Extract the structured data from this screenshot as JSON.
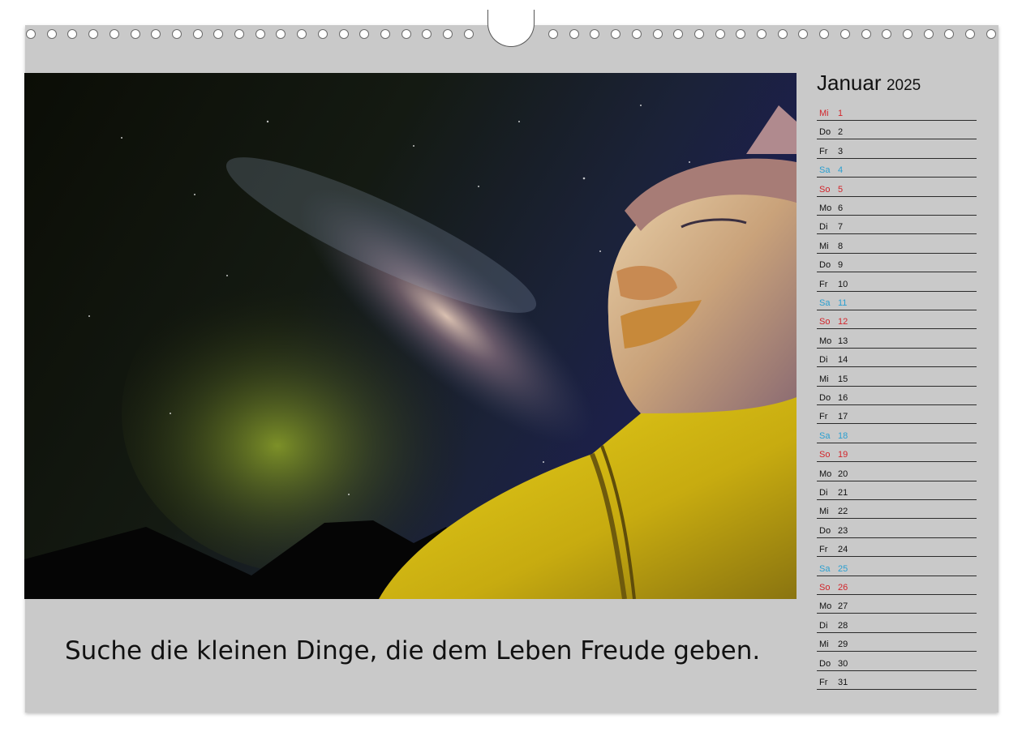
{
  "quote": "Suche die kleinen Dinge, die dem Leben Freude geben.",
  "calendar": {
    "month": "Januar",
    "year": "2025",
    "colors": {
      "weekday": "#111111",
      "saturday": "#2a9fd0",
      "sunday": "#d2252b"
    },
    "days": [
      {
        "wd": "Mi",
        "d": "1",
        "type": "holiday"
      },
      {
        "wd": "Do",
        "d": "2",
        "type": "weekday"
      },
      {
        "wd": "Fr",
        "d": "3",
        "type": "weekday"
      },
      {
        "wd": "Sa",
        "d": "4",
        "type": "saturday"
      },
      {
        "wd": "So",
        "d": "5",
        "type": "sunday"
      },
      {
        "wd": "Mo",
        "d": "6",
        "type": "weekday"
      },
      {
        "wd": "Di",
        "d": "7",
        "type": "weekday"
      },
      {
        "wd": "Mi",
        "d": "8",
        "type": "weekday"
      },
      {
        "wd": "Do",
        "d": "9",
        "type": "weekday"
      },
      {
        "wd": "Fr",
        "d": "10",
        "type": "weekday"
      },
      {
        "wd": "Sa",
        "d": "11",
        "type": "saturday"
      },
      {
        "wd": "So",
        "d": "12",
        "type": "sunday"
      },
      {
        "wd": "Mo",
        "d": "13",
        "type": "weekday"
      },
      {
        "wd": "Di",
        "d": "14",
        "type": "weekday"
      },
      {
        "wd": "Mi",
        "d": "15",
        "type": "weekday"
      },
      {
        "wd": "Do",
        "d": "16",
        "type": "weekday"
      },
      {
        "wd": "Fr",
        "d": "17",
        "type": "weekday"
      },
      {
        "wd": "Sa",
        "d": "18",
        "type": "saturday"
      },
      {
        "wd": "So",
        "d": "19",
        "type": "sunday"
      },
      {
        "wd": "Mo",
        "d": "20",
        "type": "weekday"
      },
      {
        "wd": "Di",
        "d": "21",
        "type": "weekday"
      },
      {
        "wd": "Mi",
        "d": "22",
        "type": "weekday"
      },
      {
        "wd": "Do",
        "d": "23",
        "type": "weekday"
      },
      {
        "wd": "Fr",
        "d": "24",
        "type": "weekday"
      },
      {
        "wd": "Sa",
        "d": "25",
        "type": "saturday"
      },
      {
        "wd": "So",
        "d": "26",
        "type": "sunday"
      },
      {
        "wd": "Mo",
        "d": "27",
        "type": "weekday"
      },
      {
        "wd": "Di",
        "d": "28",
        "type": "weekday"
      },
      {
        "wd": "Mi",
        "d": "29",
        "type": "weekday"
      },
      {
        "wd": "Do",
        "d": "30",
        "type": "weekday"
      },
      {
        "wd": "Fr",
        "d": "31",
        "type": "weekday"
      }
    ]
  },
  "photo": {
    "subject": "buddha-statue-milky-way-icon"
  },
  "binding": {
    "ring_icon": "binding-ring-icon",
    "hanger_icon": "hanger-notch-icon"
  }
}
